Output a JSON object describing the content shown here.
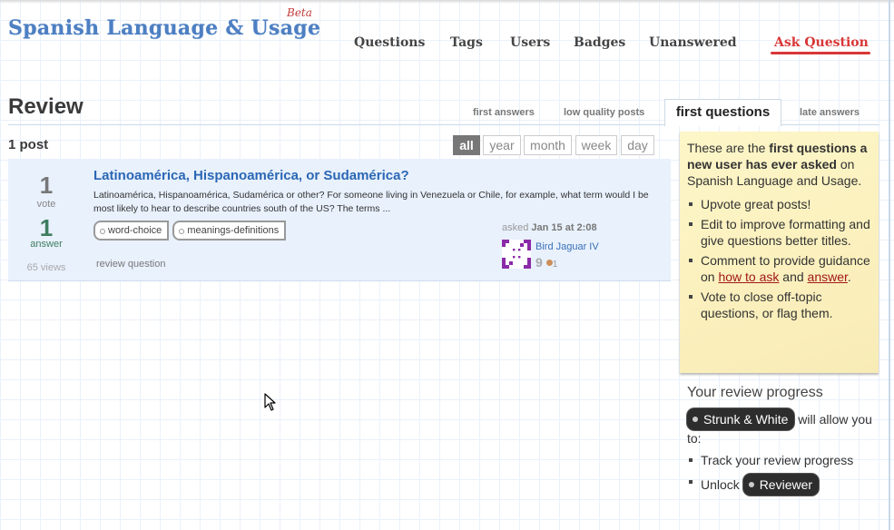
{
  "site": {
    "name": "Spanish Language & Usage",
    "beta_label": "Beta"
  },
  "nav": {
    "items": [
      "Questions",
      "Tags",
      "Users",
      "Badges",
      "Unanswered"
    ],
    "ask_label": "Ask Question"
  },
  "page": {
    "title": "Review",
    "tabs": [
      {
        "label": "first answers",
        "active": false
      },
      {
        "label": "low quality posts",
        "active": false
      },
      {
        "label": "first questions",
        "active": true
      },
      {
        "label": "late answers",
        "active": false
      }
    ],
    "post_count": "1 post",
    "filters": [
      {
        "label": "all",
        "active": true
      },
      {
        "label": "year",
        "active": false
      },
      {
        "label": "month",
        "active": false
      },
      {
        "label": "week",
        "active": false
      },
      {
        "label": "day",
        "active": false
      }
    ]
  },
  "post": {
    "votes": "1",
    "votes_label": "vote",
    "answers": "1",
    "answers_label": "answer",
    "views": "65 views",
    "title": "Latinoamérica, Hispanoamérica, or Sudamérica?",
    "excerpt": "Latinoamérica, Hispanoamérica, Sudamérica or other? For someone living in Venezuela or Chile, for example, what term would I be most likely to hear to describe countries south of the US? The terms ...",
    "tags": [
      "word-choice",
      "meanings-definitions"
    ],
    "review_link": "review question",
    "asked_prefix": "asked",
    "asked_time": "Jan 15 at 2:08",
    "user": {
      "name": "Bird Jaguar IV",
      "reputation": "9",
      "bronze_badges": "1",
      "avatar_color": "#8a2aa8"
    }
  },
  "sidebar": {
    "intro_pre": "These are the ",
    "intro_bold": "first questions a new user has ever asked",
    "intro_post": " on Spanish Language and Usage.",
    "tips": {
      "t1": "Upvote great posts!",
      "t2": "Edit to improve formatting and give questions better titles.",
      "t3_pre": "Comment to provide guidance on ",
      "t3_link1": "how to ask",
      "t3_mid": " and ",
      "t3_link2": "answer",
      "t3_post": ".",
      "t4": "Vote to close off-topic questions, or flag them."
    },
    "progress": {
      "title": "Your review progress",
      "badge": "Strunk & White",
      "will_allow": " will allow you to:",
      "item1": "Track your review progress",
      "item2_pre": "Unlock ",
      "item2_badge": "Reviewer"
    }
  }
}
